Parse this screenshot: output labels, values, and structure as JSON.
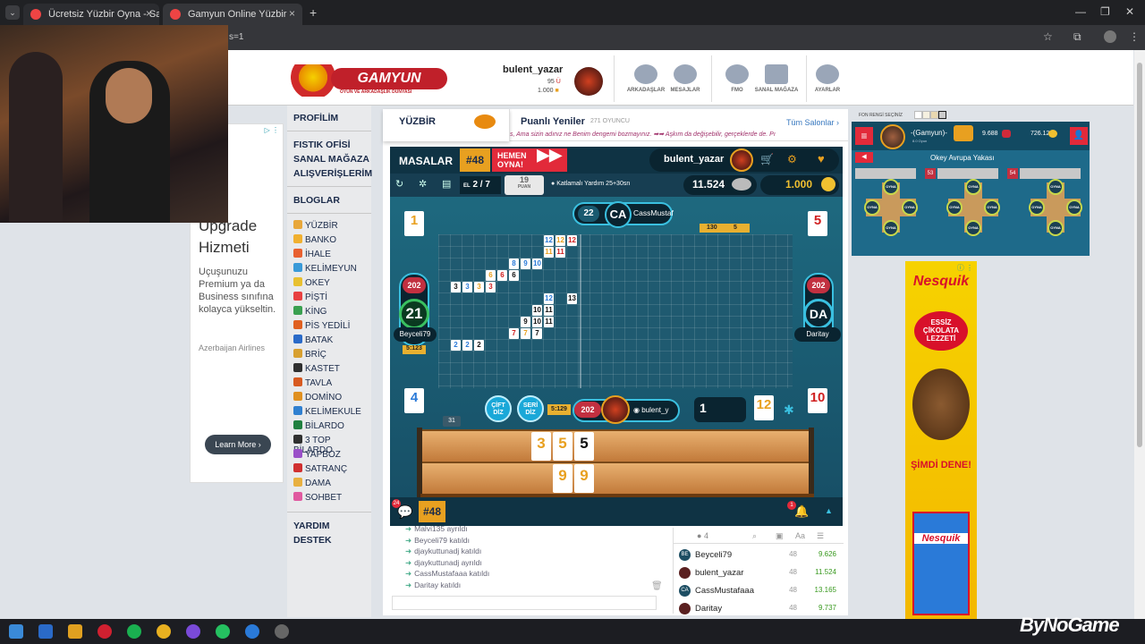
{
  "browser": {
    "tabs": [
      {
        "title": "Ücretsiz Yüzbir Oyna - Salon Li"
      },
      {
        "title": "Gamyun Online Yüzbir"
      }
    ],
    "address_fragment": "s=1"
  },
  "header": {
    "logo_text": "GAMYUN",
    "logo_sub": "OYUN VE ARKADAŞLIK DÜNYASI",
    "username": "bulent_yazar",
    "stat1": "95",
    "stat2": "1.000",
    "icons": [
      {
        "label": "ARKADAŞLAR"
      },
      {
        "label": "MESAJLAR"
      },
      {
        "label": "FMO"
      },
      {
        "label": "SANAL MAĞAZA"
      },
      {
        "label": "AYARLAR"
      }
    ]
  },
  "leftnav": {
    "sections": [
      "PROFİLİM",
      "FISTIK OFİSİ",
      "SANAL MAĞAZA",
      "ALIŞVERİŞLERİM",
      "BLOGLAR",
      "YARDIM",
      "DESTEK"
    ],
    "games": [
      "YÜZBİR",
      "BANKO",
      "İHALE",
      "KELİMEYUN",
      "OKEY",
      "PİŞTİ",
      "KİNG",
      "PİS YEDİLİ",
      "BATAK",
      "BRİÇ",
      "KASTET",
      "TAVLA",
      "DOMİNO",
      "KELİMEKULE",
      "BİLARDO",
      "3 TOP BİLARDO",
      "YAPBOZ",
      "SATRANÇ",
      "DAMA",
      "SOHBET"
    ],
    "game_colors": [
      "#e8a73a",
      "#f0b030",
      "#e86030",
      "#3a9ad8",
      "#e8c030",
      "#e84040",
      "#3aa050",
      "#e06020",
      "#2a6ac8",
      "#d8a030",
      "#303030",
      "#d85a20",
      "#e09020",
      "#3080d0",
      "#208040",
      "#303030",
      "#9a50c8",
      "#d03030",
      "#e8b040",
      "#e05aa0"
    ]
  },
  "ad_left": {
    "line1": "Upgrade",
    "line2": "Hizmeti",
    "body": "Uçuşunuzu Premium ya da Business sınıfına kolayca yükseltin.",
    "brand": "Azerbaijan Airlines",
    "cta": "Learn More"
  },
  "game": {
    "title": "YÜZBİR",
    "subtitle": "Puanlı Yeniler",
    "players_count": "271 OYUNCU",
    "all_rooms": "Tüm Salonlar",
    "marquee": "s, Ama sizin adınız ne Benim dengemi bozmayınız. ➡➡ Aşkım da değişebilir, gerçeklerde de. Pı",
    "tables_label": "MASALAR",
    "table_no": "#48",
    "play_now": "HEMEN OYNA!",
    "me_name": "bulent_yazar",
    "round_label": "EL",
    "round": "2 / 7",
    "points_box": "19",
    "points_box_label": "PUAN",
    "mode": "Katlamalı Yardım 25+30sn",
    "my_score": "11.524",
    "my_coins": "1.000",
    "top_player": {
      "badge": "22",
      "initials": "CA",
      "name": "CassMustaf"
    },
    "left_player": {
      "points": "202",
      "badge": "21",
      "name": "Beyceli79",
      "extra": "5:123"
    },
    "right_player": {
      "points": "202",
      "initials": "DA",
      "name": "Daritay"
    },
    "bottom_player": {
      "points": "202",
      "name": "bulent_y",
      "timer": "5:129"
    },
    "corner_tiles": [
      "1",
      "5",
      "4",
      "10"
    ],
    "deck_count": "1",
    "indicator_tile": "12",
    "discard_count": "31",
    "grid_labels": [
      "130",
      "5"
    ],
    "buttons": {
      "double": "ÇİFT DİZ",
      "series": "SERİ DİZ"
    },
    "rack_top": [
      "3",
      "5",
      "5"
    ],
    "rack_bottom": [
      "9",
      "9"
    ],
    "bottom_table": "#48",
    "chat_badge": "24",
    "notif_badge": "1"
  },
  "board_tiles": [
    {
      "r": 0,
      "c": 9,
      "v": "12",
      "col": "#2a7ad8"
    },
    {
      "r": 0,
      "c": 10,
      "v": "12",
      "col": "#e8a020"
    },
    {
      "r": 0,
      "c": 11,
      "v": "12",
      "col": "#d02020"
    },
    {
      "r": 1,
      "c": 9,
      "v": "11",
      "col": "#e8a020"
    },
    {
      "r": 1,
      "c": 10,
      "v": "11",
      "col": "#d02020"
    },
    {
      "r": 2,
      "c": 6,
      "v": "8",
      "col": "#2a7ad8"
    },
    {
      "r": 2,
      "c": 7,
      "v": "9",
      "col": "#2a7ad8"
    },
    {
      "r": 2,
      "c": 8,
      "v": "10",
      "col": "#2a7ad8"
    },
    {
      "r": 3,
      "c": 4,
      "v": "6",
      "col": "#e8a020"
    },
    {
      "r": 3,
      "c": 5,
      "v": "6",
      "col": "#d02020"
    },
    {
      "r": 3,
      "c": 6,
      "v": "6",
      "col": "#111"
    },
    {
      "r": 4,
      "c": 1,
      "v": "3",
      "col": "#111"
    },
    {
      "r": 4,
      "c": 2,
      "v": "3",
      "col": "#2a7ad8"
    },
    {
      "r": 4,
      "c": 3,
      "v": "3",
      "col": "#e8a020"
    },
    {
      "r": 4,
      "c": 4,
      "v": "3",
      "col": "#d02020"
    },
    {
      "r": 5,
      "c": 9,
      "v": "12",
      "col": "#2a7ad8"
    },
    {
      "r": 5,
      "c": 11,
      "v": "13",
      "col": "#111"
    },
    {
      "r": 6,
      "c": 8,
      "v": "10",
      "col": "#111"
    },
    {
      "r": 6,
      "c": 9,
      "v": "11",
      "col": "#111"
    },
    {
      "r": 7,
      "c": 7,
      "v": "9",
      "col": "#111"
    },
    {
      "r": 7,
      "c": 8,
      "v": "10",
      "col": "#111"
    },
    {
      "r": 7,
      "c": 9,
      "v": "11",
      "col": "#111"
    },
    {
      "r": 8,
      "c": 6,
      "v": "7",
      "col": "#d02020"
    },
    {
      "r": 8,
      "c": 7,
      "v": "7",
      "col": "#e8a020"
    },
    {
      "r": 8,
      "c": 8,
      "v": "7",
      "col": "#111"
    },
    {
      "r": 9,
      "c": 1,
      "v": "2",
      "col": "#2a7ad8"
    },
    {
      "r": 9,
      "c": 2,
      "v": "2",
      "col": "#2a7ad8"
    },
    {
      "r": 9,
      "c": 3,
      "v": "2",
      "col": "#111"
    }
  ],
  "chat": {
    "lines": [
      "Malvi135 ayrıldı",
      "Beyceli79 katıldı",
      "djaykuttunadj katıldı",
      "djaykuttunadj ayrıldı",
      "CassMustafaaa katıldı",
      "Daritay katıldı"
    ]
  },
  "players_panel": {
    "count": "4",
    "rows": [
      {
        "av": "BE",
        "name": "Beyceli79",
        "count": "48",
        "score": "9.626"
      },
      {
        "av": "",
        "name": "bulent_yazar",
        "count": "48",
        "score": "11.524"
      },
      {
        "av": "CA",
        "name": "CassMustafaaa",
        "count": "48",
        "score": "13.165"
      },
      {
        "av": "",
        "name": "Daritay",
        "count": "48",
        "score": "9.737"
      }
    ]
  },
  "right_panel": {
    "bg_label": "FON RENGİ SEÇİNİZ",
    "name": "-(Gamyun)-",
    "level": "8.0 Oyun",
    "coins1": "9.688",
    "coins2": "726.124",
    "room": "Okey Avrupa Yakası",
    "tables": [
      "53",
      "54"
    ],
    "seat_label": "OYNA"
  },
  "ad_right": {
    "brand": "Nesquik",
    "tagline": "ESSİZ ÇİKOLATA LEZZETİ",
    "cta": "ŞİMDİ DENE!"
  },
  "watermark": "ByNoGame"
}
